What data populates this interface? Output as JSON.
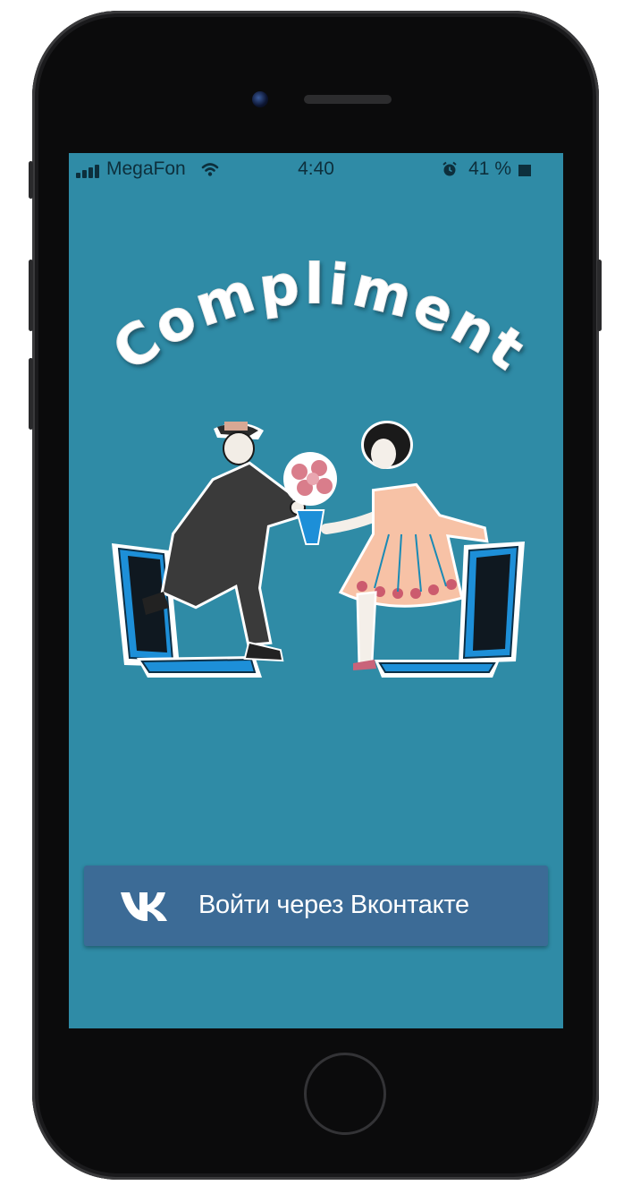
{
  "status_bar": {
    "carrier": "MegaFon",
    "time": "4:40",
    "battery_percent": "41 %",
    "icons": [
      "signal-icon",
      "wifi-icon",
      "alarm-icon",
      "battery-icon"
    ]
  },
  "app": {
    "title": "Compliment",
    "illustration": "couple-handing-flowers-through-laptops"
  },
  "login": {
    "button_label": "Войти через Вконтакте",
    "button_icon": "vk-logo-icon"
  },
  "colors": {
    "background": "#2f8ba6",
    "button": "#3c6b96",
    "text_light": "#ffffff"
  }
}
